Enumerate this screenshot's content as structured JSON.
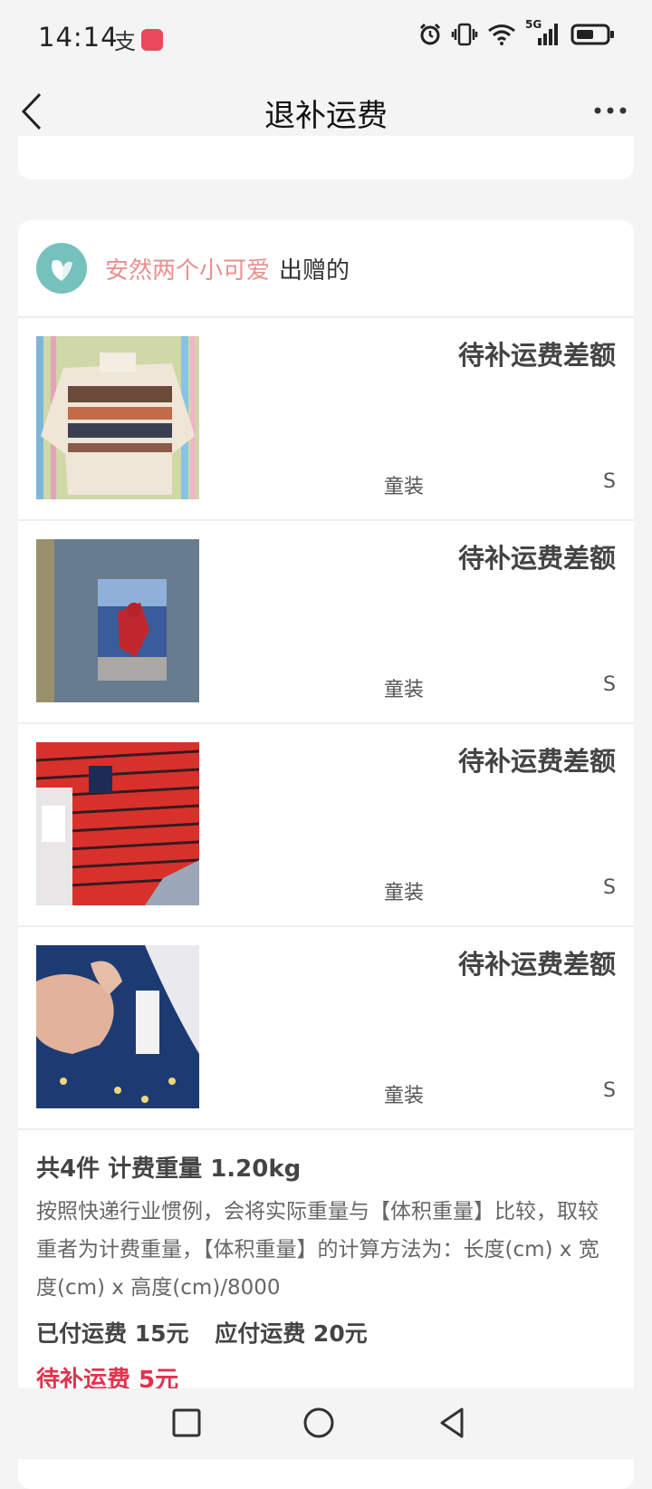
{
  "status_bar": {
    "time": "14:14",
    "icons": [
      "alipay-icon",
      "app-notification-icon",
      "alarm-icon",
      "vibrate-icon",
      "wifi-icon",
      "5g-signal-icon",
      "battery-icon"
    ],
    "network": "5G"
  },
  "nav": {
    "title": "退补运费",
    "back_icon": "chevron-left-icon",
    "more_icon": "more-dots-icon"
  },
  "donor": {
    "name": "安然两个小可爱",
    "suffix": "出赠的",
    "name_color": "#e7908f",
    "avatar_color": "#76c0bd"
  },
  "items": [
    {
      "title": "待补运费差额",
      "category": "童装",
      "size": "S",
      "image": "knit-sweater-photo"
    },
    {
      "title": "待补运费差额",
      "category": "童装",
      "size": "S",
      "image": "denim-vest-spiderman-photo"
    },
    {
      "title": "待补运费差额",
      "category": "童装",
      "size": "S",
      "image": "red-striped-jacket-photo"
    },
    {
      "title": "待补运费差额",
      "category": "童装",
      "size": "S",
      "image": "navy-jacket-photo"
    }
  ],
  "summary": {
    "count_weight": "共4件 计费重量 1.20kg",
    "description": "按照快递行业惯例，会将实际重量与【体积重量】比较，取较重者为计费重量，【体积重量】的计算方法为：长度(cm) x 宽度(cm) x 高度(cm)/8000",
    "paid": "已付运费 15元",
    "due": "应付运费 20元",
    "difference": "待补运费 5元",
    "difference_color": "#e0334f"
  },
  "bottom_nav": {
    "icons": [
      "recent-apps-icon",
      "home-icon",
      "back-icon"
    ]
  }
}
